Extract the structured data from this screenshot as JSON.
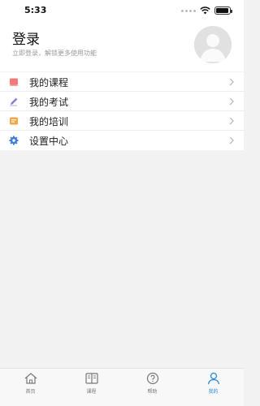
{
  "status_bar": {
    "time": "5:33"
  },
  "header": {
    "title": "登录",
    "subtitle": "立即登录，解锁更多使用功能"
  },
  "menu": {
    "items": [
      {
        "label": "我的课程",
        "icon": "course-book-icon",
        "color": "#f07a7a"
      },
      {
        "label": "我的考试",
        "icon": "pen-icon",
        "color": "#8a7bd6"
      },
      {
        "label": "我的培训",
        "icon": "training-icon",
        "color": "#f2a64a"
      },
      {
        "label": "设置中心",
        "icon": "gear-icon",
        "color": "#3f7fd9"
      }
    ]
  },
  "tabbar": {
    "active_color": "#2a8ad4",
    "tabs": [
      {
        "label": "首页",
        "icon": "home-icon"
      },
      {
        "label": "课程",
        "icon": "book-icon"
      },
      {
        "label": "帮助",
        "icon": "help-icon"
      },
      {
        "label": "我的",
        "icon": "profile-icon",
        "active": true
      }
    ]
  }
}
